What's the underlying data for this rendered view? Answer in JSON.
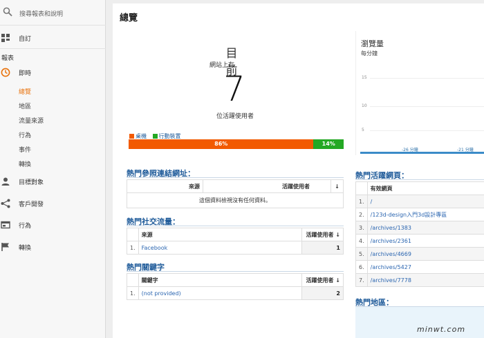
{
  "sidebar": {
    "search_placeholder": "搜尋報表和說明",
    "items": [
      {
        "label": "自訂",
        "icon": "dashboard-grid-icon"
      },
      {
        "label": "即時",
        "icon": "clock-icon"
      },
      {
        "label": "目標對象",
        "icon": "person-icon"
      },
      {
        "label": "客戶開發",
        "icon": "acquisition-icon"
      },
      {
        "label": "行為",
        "icon": "behavior-icon"
      },
      {
        "label": "轉換",
        "icon": "flag-icon"
      }
    ],
    "section_label": "報表",
    "realtime_sub": [
      "總覽",
      "地區",
      "流量來源",
      "行為",
      "事件",
      "轉換"
    ]
  },
  "main": {
    "title": "總覽",
    "now_title": "目前",
    "now_subtitle": "網站上有",
    "active_users": "7",
    "active_users_label": "位活躍使用者",
    "device_legend": [
      {
        "label": "桌機",
        "color": "#f25a00"
      },
      {
        "label": "行動裝置",
        "color": "#23a823"
      }
    ],
    "device_split": [
      {
        "label": "86%",
        "value": 86,
        "color": "#f25a00"
      },
      {
        "label": "14%",
        "value": 14,
        "color": "#23a823"
      }
    ],
    "pageviews": {
      "title": "瀏覽量",
      "subtitle": "每分鐘",
      "y_ticks": [
        "15",
        "10",
        "5"
      ],
      "x_ticks": [
        "-26 分鐘",
        "-21 分鐘"
      ]
    },
    "referrals": {
      "title": "熱門參照連結網址：",
      "col_source": "來源",
      "col_active": "活躍使用者",
      "sort_icon": "↓",
      "empty_text": "這個資料檢視沒有任何資料。"
    },
    "social": {
      "title": "熱門社交流量：",
      "col_source": "來源",
      "col_active": "活躍使用者",
      "sort_icon": "↓",
      "rows": [
        {
          "num": "1.",
          "name": "Facebook",
          "value": "1"
        }
      ]
    },
    "keywords": {
      "title": "熱門關鍵字",
      "col_keyword": "關鍵字",
      "col_active": "活躍使用者",
      "sort_icon": "↓",
      "rows": [
        {
          "num": "1.",
          "name": "(not provided)",
          "value": "2"
        }
      ]
    },
    "active_pages": {
      "title": "熱門活躍網頁：",
      "col_page": "有效網頁",
      "rows": [
        {
          "num": "1.",
          "name": "/"
        },
        {
          "num": "2.",
          "name": "/123d-design入門3d設計專區"
        },
        {
          "num": "3.",
          "name": "/archives/1383"
        },
        {
          "num": "4.",
          "name": "/archives/2361"
        },
        {
          "num": "5.",
          "name": "/archives/4669"
        },
        {
          "num": "6.",
          "name": "/archives/5427"
        },
        {
          "num": "7.",
          "name": "/archives/7778"
        }
      ]
    },
    "locations": {
      "title": "熱門地區："
    },
    "watermark": "minwt.com"
  }
}
